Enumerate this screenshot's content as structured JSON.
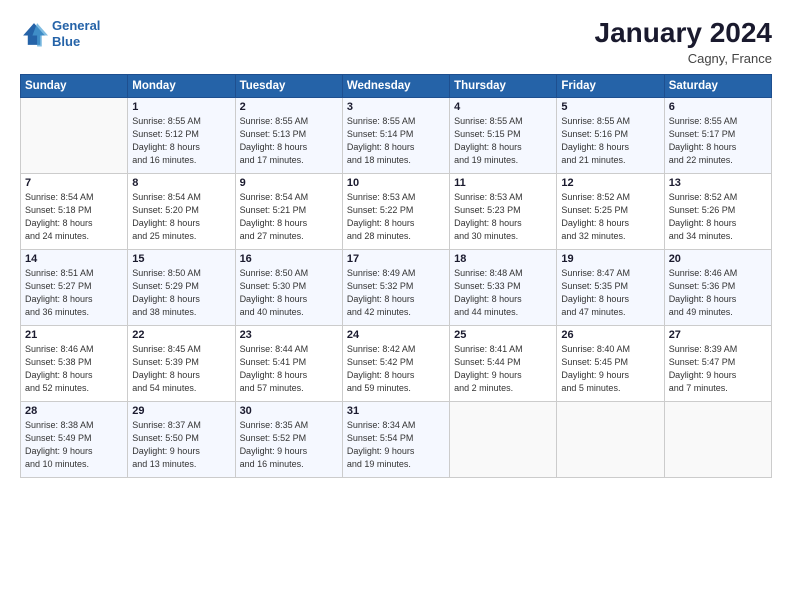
{
  "header": {
    "logo_line1": "General",
    "logo_line2": "Blue",
    "month": "January 2024",
    "location": "Cagny, France"
  },
  "weekdays": [
    "Sunday",
    "Monday",
    "Tuesday",
    "Wednesday",
    "Thursday",
    "Friday",
    "Saturday"
  ],
  "weeks": [
    [
      {
        "day": "",
        "sunrise": "",
        "sunset": "",
        "daylight": ""
      },
      {
        "day": "1",
        "sunrise": "Sunrise: 8:55 AM",
        "sunset": "Sunset: 5:12 PM",
        "daylight": "Daylight: 8 hours and 16 minutes."
      },
      {
        "day": "2",
        "sunrise": "Sunrise: 8:55 AM",
        "sunset": "Sunset: 5:13 PM",
        "daylight": "Daylight: 8 hours and 17 minutes."
      },
      {
        "day": "3",
        "sunrise": "Sunrise: 8:55 AM",
        "sunset": "Sunset: 5:14 PM",
        "daylight": "Daylight: 8 hours and 18 minutes."
      },
      {
        "day": "4",
        "sunrise": "Sunrise: 8:55 AM",
        "sunset": "Sunset: 5:15 PM",
        "daylight": "Daylight: 8 hours and 19 minutes."
      },
      {
        "day": "5",
        "sunrise": "Sunrise: 8:55 AM",
        "sunset": "Sunset: 5:16 PM",
        "daylight": "Daylight: 8 hours and 21 minutes."
      },
      {
        "day": "6",
        "sunrise": "Sunrise: 8:55 AM",
        "sunset": "Sunset: 5:17 PM",
        "daylight": "Daylight: 8 hours and 22 minutes."
      }
    ],
    [
      {
        "day": "7",
        "sunrise": "Sunrise: 8:54 AM",
        "sunset": "Sunset: 5:18 PM",
        "daylight": "Daylight: 8 hours and 24 minutes."
      },
      {
        "day": "8",
        "sunrise": "Sunrise: 8:54 AM",
        "sunset": "Sunset: 5:20 PM",
        "daylight": "Daylight: 8 hours and 25 minutes."
      },
      {
        "day": "9",
        "sunrise": "Sunrise: 8:54 AM",
        "sunset": "Sunset: 5:21 PM",
        "daylight": "Daylight: 8 hours and 27 minutes."
      },
      {
        "day": "10",
        "sunrise": "Sunrise: 8:53 AM",
        "sunset": "Sunset: 5:22 PM",
        "daylight": "Daylight: 8 hours and 28 minutes."
      },
      {
        "day": "11",
        "sunrise": "Sunrise: 8:53 AM",
        "sunset": "Sunset: 5:23 PM",
        "daylight": "Daylight: 8 hours and 30 minutes."
      },
      {
        "day": "12",
        "sunrise": "Sunrise: 8:52 AM",
        "sunset": "Sunset: 5:25 PM",
        "daylight": "Daylight: 8 hours and 32 minutes."
      },
      {
        "day": "13",
        "sunrise": "Sunrise: 8:52 AM",
        "sunset": "Sunset: 5:26 PM",
        "daylight": "Daylight: 8 hours and 34 minutes."
      }
    ],
    [
      {
        "day": "14",
        "sunrise": "Sunrise: 8:51 AM",
        "sunset": "Sunset: 5:27 PM",
        "daylight": "Daylight: 8 hours and 36 minutes."
      },
      {
        "day": "15",
        "sunrise": "Sunrise: 8:50 AM",
        "sunset": "Sunset: 5:29 PM",
        "daylight": "Daylight: 8 hours and 38 minutes."
      },
      {
        "day": "16",
        "sunrise": "Sunrise: 8:50 AM",
        "sunset": "Sunset: 5:30 PM",
        "daylight": "Daylight: 8 hours and 40 minutes."
      },
      {
        "day": "17",
        "sunrise": "Sunrise: 8:49 AM",
        "sunset": "Sunset: 5:32 PM",
        "daylight": "Daylight: 8 hours and 42 minutes."
      },
      {
        "day": "18",
        "sunrise": "Sunrise: 8:48 AM",
        "sunset": "Sunset: 5:33 PM",
        "daylight": "Daylight: 8 hours and 44 minutes."
      },
      {
        "day": "19",
        "sunrise": "Sunrise: 8:47 AM",
        "sunset": "Sunset: 5:35 PM",
        "daylight": "Daylight: 8 hours and 47 minutes."
      },
      {
        "day": "20",
        "sunrise": "Sunrise: 8:46 AM",
        "sunset": "Sunset: 5:36 PM",
        "daylight": "Daylight: 8 hours and 49 minutes."
      }
    ],
    [
      {
        "day": "21",
        "sunrise": "Sunrise: 8:46 AM",
        "sunset": "Sunset: 5:38 PM",
        "daylight": "Daylight: 8 hours and 52 minutes."
      },
      {
        "day": "22",
        "sunrise": "Sunrise: 8:45 AM",
        "sunset": "Sunset: 5:39 PM",
        "daylight": "Daylight: 8 hours and 54 minutes."
      },
      {
        "day": "23",
        "sunrise": "Sunrise: 8:44 AM",
        "sunset": "Sunset: 5:41 PM",
        "daylight": "Daylight: 8 hours and 57 minutes."
      },
      {
        "day": "24",
        "sunrise": "Sunrise: 8:42 AM",
        "sunset": "Sunset: 5:42 PM",
        "daylight": "Daylight: 8 hours and 59 minutes."
      },
      {
        "day": "25",
        "sunrise": "Sunrise: 8:41 AM",
        "sunset": "Sunset: 5:44 PM",
        "daylight": "Daylight: 9 hours and 2 minutes."
      },
      {
        "day": "26",
        "sunrise": "Sunrise: 8:40 AM",
        "sunset": "Sunset: 5:45 PM",
        "daylight": "Daylight: 9 hours and 5 minutes."
      },
      {
        "day": "27",
        "sunrise": "Sunrise: 8:39 AM",
        "sunset": "Sunset: 5:47 PM",
        "daylight": "Daylight: 9 hours and 7 minutes."
      }
    ],
    [
      {
        "day": "28",
        "sunrise": "Sunrise: 8:38 AM",
        "sunset": "Sunset: 5:49 PM",
        "daylight": "Daylight: 9 hours and 10 minutes."
      },
      {
        "day": "29",
        "sunrise": "Sunrise: 8:37 AM",
        "sunset": "Sunset: 5:50 PM",
        "daylight": "Daylight: 9 hours and 13 minutes."
      },
      {
        "day": "30",
        "sunrise": "Sunrise: 8:35 AM",
        "sunset": "Sunset: 5:52 PM",
        "daylight": "Daylight: 9 hours and 16 minutes."
      },
      {
        "day": "31",
        "sunrise": "Sunrise: 8:34 AM",
        "sunset": "Sunset: 5:54 PM",
        "daylight": "Daylight: 9 hours and 19 minutes."
      },
      {
        "day": "",
        "sunrise": "",
        "sunset": "",
        "daylight": ""
      },
      {
        "day": "",
        "sunrise": "",
        "sunset": "",
        "daylight": ""
      },
      {
        "day": "",
        "sunrise": "",
        "sunset": "",
        "daylight": ""
      }
    ]
  ]
}
